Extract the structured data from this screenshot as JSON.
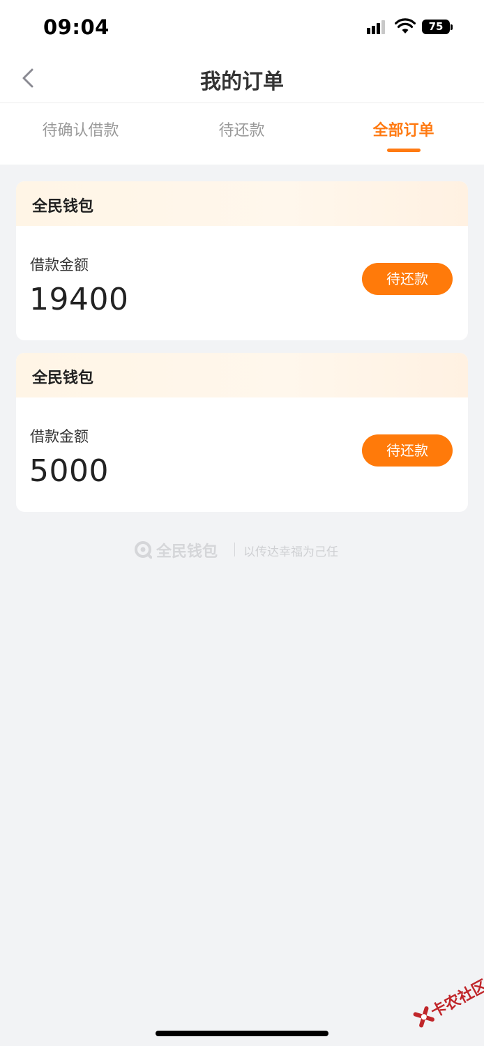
{
  "status_bar": {
    "time": "09:04",
    "battery": "75"
  },
  "nav": {
    "title": "我的订单"
  },
  "tabs": [
    {
      "label": "待确认借款",
      "active": false
    },
    {
      "label": "待还款",
      "active": false
    },
    {
      "label": "全部订单",
      "active": true
    }
  ],
  "orders": [
    {
      "brand": "全民钱包",
      "amount_label": "借款金额",
      "amount": "19400",
      "status": "待还款"
    },
    {
      "brand": "全民钱包",
      "amount_label": "借款金额",
      "amount": "5000",
      "status": "待还款"
    }
  ],
  "footer": {
    "brand": "全民钱包",
    "slogan": "以传达幸福为己任"
  },
  "watermark": {
    "text": "卡农社区"
  },
  "colors": {
    "accent": "#ff7a12",
    "button": "#ff7a0a",
    "card_header": "#fff5e6",
    "background": "#f2f3f5",
    "inactive_tab": "#999999"
  }
}
